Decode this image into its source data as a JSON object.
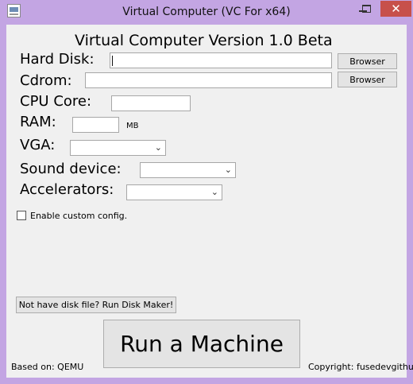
{
  "window": {
    "title": "Virtual Computer (VC For x64)"
  },
  "heading": "Virtual Computer Version 1.0 Beta",
  "fields": {
    "hard_disk": {
      "label": "Hard Disk:",
      "value": "",
      "button": "Browser"
    },
    "cdrom": {
      "label": "Cdrom:",
      "value": "",
      "button": "Browser"
    },
    "cpu_core": {
      "label": "CPU Core:",
      "value": ""
    },
    "ram": {
      "label": "RAM:",
      "value": "",
      "unit": "MB"
    },
    "vga": {
      "label": "VGA:",
      "value": ""
    },
    "sound_device": {
      "label": "Sound device:",
      "value": ""
    },
    "accelerators": {
      "label": "Accelerators:",
      "value": ""
    }
  },
  "custom_config": {
    "label": "Enable custom config.",
    "checked": false
  },
  "disk_maker_button": "Not have disk file? Run Disk Maker!",
  "run_button": "Run a Machine",
  "footer": {
    "based_on": "Based on: QEMU",
    "copyright": "Copyright: fusedevgithub"
  },
  "icons": {
    "window_controls": [
      "minimize-icon",
      "maximize-icon",
      "close-icon"
    ],
    "dropdown": "chevron-down-icon"
  },
  "colors": {
    "frame": "#c3a5e3",
    "close_button": "#c7504b",
    "client_bg": "#f0f0f0"
  }
}
